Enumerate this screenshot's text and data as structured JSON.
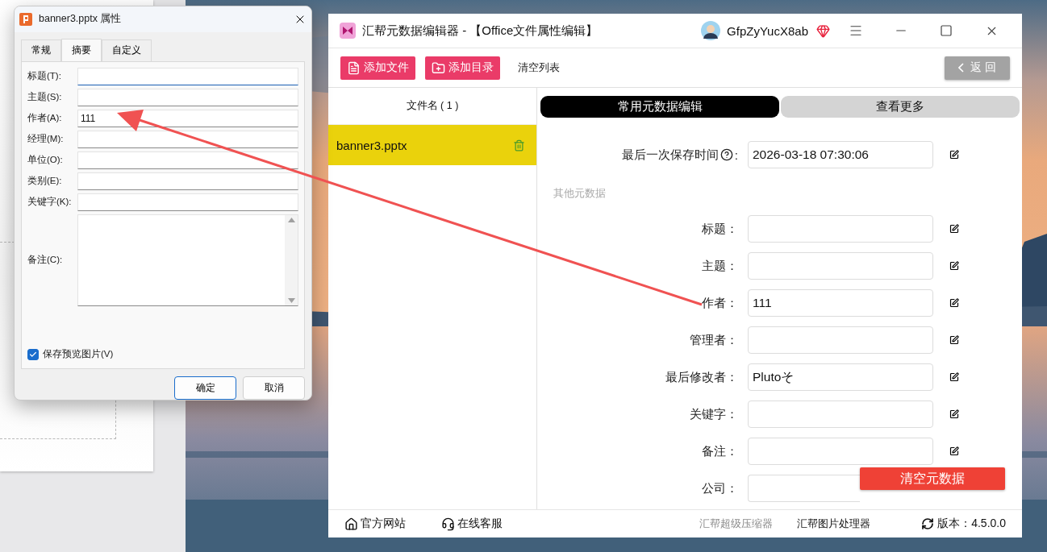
{
  "dialog": {
    "title": "banner3.pptx 属性",
    "tabs": [
      {
        "label": "常规",
        "selected": false
      },
      {
        "label": "摘要",
        "selected": true
      },
      {
        "label": "自定义",
        "selected": false
      }
    ],
    "fields": [
      {
        "label": "标题(T):",
        "focused": true
      },
      {
        "label": "主题(S):",
        "focused": false
      },
      {
        "label": "作者(A):",
        "value": "111",
        "focused": false
      },
      {
        "label": "经理(M):",
        "focused": false
      },
      {
        "label": "单位(O):",
        "focused": false
      },
      {
        "label": "类别(E):",
        "focused": false
      },
      {
        "label": "关键字(K):",
        "focused": false
      }
    ],
    "notes_label": "备注(C):",
    "checkbox": {
      "label": "保存预览图片(V)",
      "checked": true
    },
    "buttons": [
      {
        "label": "确定",
        "default": true
      },
      {
        "label": "取消",
        "default": false
      }
    ]
  },
  "app": {
    "title": "汇帮元数据编辑器 - 【Office文件属性编辑】",
    "user": "GfpZyYucX8ab",
    "toolbar": [
      {
        "label": "添加文件",
        "kind": "add-file"
      },
      {
        "label": "添加目录",
        "kind": "add-folder"
      },
      {
        "label": "清空列表",
        "kind": "text"
      }
    ],
    "back": "返 回",
    "file_list": {
      "header": "文件名 ( 1 )",
      "files": [
        {
          "name": "banner3.pptx",
          "selected": true
        }
      ]
    },
    "tabs": [
      {
        "label": "常用元数据编辑",
        "selected": true
      },
      {
        "label": "查看更多",
        "selected": false
      }
    ],
    "common_rows": [
      {
        "label": "最后一次保存时间",
        "help": true,
        "colon": ":",
        "value": "2026-03-18 07:30:06"
      }
    ],
    "section": "其他元数据",
    "other_rows": [
      {
        "label": "标题：",
        "edit": true
      },
      {
        "label": "主题：",
        "edit": true
      },
      {
        "label": "作者：",
        "value": "111",
        "edit": true
      },
      {
        "label": "管理者：",
        "edit": true
      },
      {
        "label": "最后修改者：",
        "value": "Plutoそ",
        "edit": true
      },
      {
        "label": "关键字：",
        "edit": true
      },
      {
        "label": "备注：",
        "edit": true
      },
      {
        "label": "公司：",
        "edit": false
      }
    ],
    "clear_button": "清空元数据",
    "footer": {
      "links": [
        {
          "label": "官方网站",
          "kind": "home"
        },
        {
          "label": "在线客服",
          "kind": "support"
        }
      ],
      "products": [
        {
          "label": "汇帮超级压缩器",
          "muted": true
        },
        {
          "label": "汇帮图片处理器",
          "muted": false
        }
      ],
      "version": "版本：4.5.0.0"
    }
  }
}
